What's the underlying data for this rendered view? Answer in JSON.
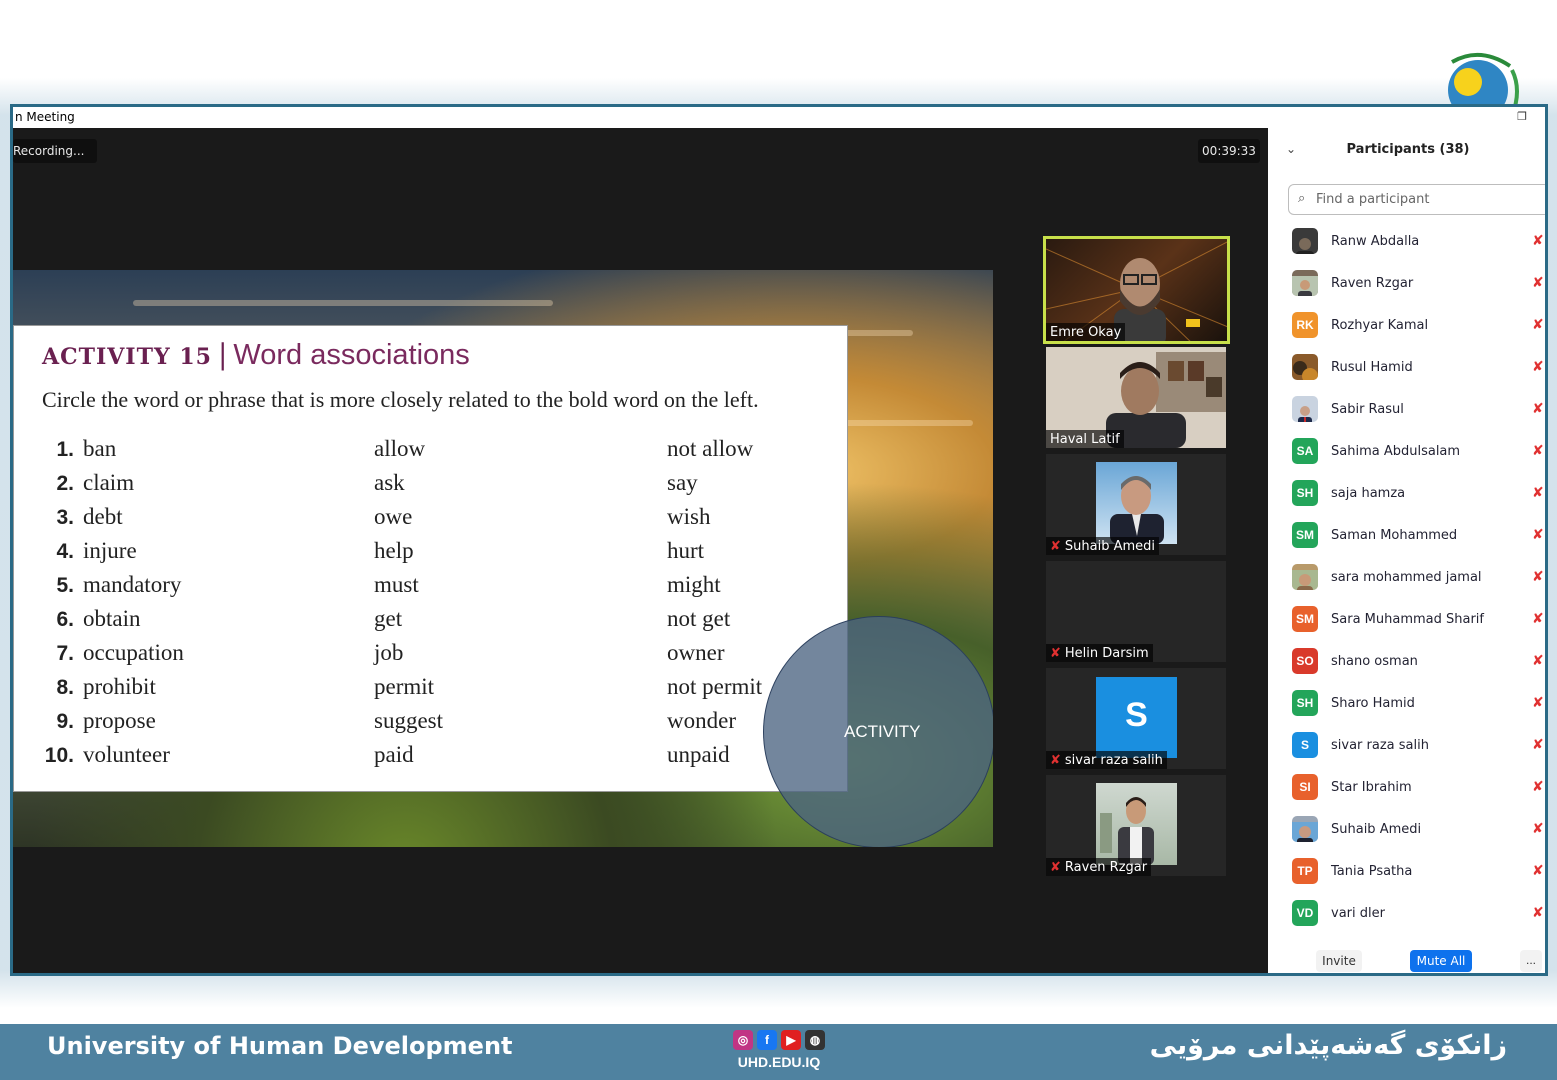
{
  "window": {
    "title": "n Meeting",
    "restore_icon": "restore-icon"
  },
  "meeting": {
    "recording_label": "Recording...",
    "timer": "00:39:33"
  },
  "slide": {
    "activity_number": "ACTIVITY 15",
    "separator": "|",
    "activity_name": "Word associations",
    "instructions": "Circle the word or phrase that is more closely related to the bold word on the left.",
    "items": [
      {
        "num": "1.",
        "word": "ban",
        "a": "allow",
        "b": "not allow"
      },
      {
        "num": "2.",
        "word": "claim",
        "a": "ask",
        "b": "say"
      },
      {
        "num": "3.",
        "word": "debt",
        "a": "owe",
        "b": "wish"
      },
      {
        "num": "4.",
        "word": "injure",
        "a": "help",
        "b": "hurt"
      },
      {
        "num": "5.",
        "word": "mandatory",
        "a": "must",
        "b": "might"
      },
      {
        "num": "6.",
        "word": "obtain",
        "a": "get",
        "b": "not get"
      },
      {
        "num": "7.",
        "word": "occupation",
        "a": "job",
        "b": "owner"
      },
      {
        "num": "8.",
        "word": "prohibit",
        "a": "permit",
        "b": "not permit"
      },
      {
        "num": "9.",
        "word": "propose",
        "a": "suggest",
        "b": "wonder"
      },
      {
        "num": "10.",
        "word": "volunteer",
        "a": "paid",
        "b": "unpaid"
      }
    ],
    "overlay_label": "ACTIVITY"
  },
  "video_tiles": [
    {
      "name": "Emre Okay",
      "muted": false,
      "active": true
    },
    {
      "name": "Haval Latif",
      "muted": false,
      "active": false
    },
    {
      "name": "Suhaib Amedi",
      "muted": true,
      "active": false
    },
    {
      "name": "Helin Darsim",
      "muted": true,
      "active": false
    },
    {
      "name": "sivar raza salih",
      "muted": true,
      "active": false,
      "avatar_letter": "S"
    },
    {
      "name": "Raven Rzgar",
      "muted": true,
      "active": false
    }
  ],
  "participants_panel": {
    "title": "Participants (38)",
    "search_placeholder": "Find a participant",
    "participants": [
      {
        "name": "Ranw Abdalla",
        "initials": "",
        "color": "#3a3a3a"
      },
      {
        "name": "Raven Rzgar",
        "initials": "",
        "color": "#7a6a5a"
      },
      {
        "name": "Rozhyar Kamal",
        "initials": "RK",
        "color": "#f0932b"
      },
      {
        "name": "Rusul Hamid",
        "initials": "",
        "color": "#8a5a2a"
      },
      {
        "name": "Sabir Rasul",
        "initials": "",
        "color": "#c9d3e0"
      },
      {
        "name": "Sahima Abdulsalam",
        "initials": "SA",
        "color": "#23a55a"
      },
      {
        "name": "saja hamza",
        "initials": "SH",
        "color": "#23a55a"
      },
      {
        "name": "Saman Mohammed",
        "initials": "SM",
        "color": "#23a55a"
      },
      {
        "name": "sara mohammed jamal",
        "initials": "",
        "color": "#b89a6a"
      },
      {
        "name": "Sara Muhammad Sharif",
        "initials": "SM",
        "color": "#e8612c"
      },
      {
        "name": "shano osman",
        "initials": "SO",
        "color": "#d93a2b"
      },
      {
        "name": "Sharo Hamid",
        "initials": "SH",
        "color": "#23a55a"
      },
      {
        "name": "sivar raza salih",
        "initials": "S",
        "color": "#1a8fe0"
      },
      {
        "name": "Star Ibrahim",
        "initials": "SI",
        "color": "#e8612c"
      },
      {
        "name": "Suhaib Amedi",
        "initials": "",
        "color": "#9aa6b5"
      },
      {
        "name": "Tania Psatha",
        "initials": "TP",
        "color": "#e8612c"
      },
      {
        "name": "vari dler",
        "initials": "VD",
        "color": "#23a55a"
      }
    ],
    "invite_label": "Invite",
    "mute_all_label": "Mute All",
    "more_label": "..."
  },
  "footer": {
    "left_text": "University of Human Development",
    "right_text": "زانكۆی گەشەپێدانی مرۆیی",
    "website": "UHD.EDU.IQ",
    "social_icons": [
      "instagram-icon",
      "facebook-icon",
      "youtube-icon",
      "web-icon"
    ]
  },
  "colors": {
    "accent": "#0e72ed",
    "active_speaker": "#c8e04a",
    "footer_bg": "#4f82a0",
    "muted_red": "#e03131"
  }
}
